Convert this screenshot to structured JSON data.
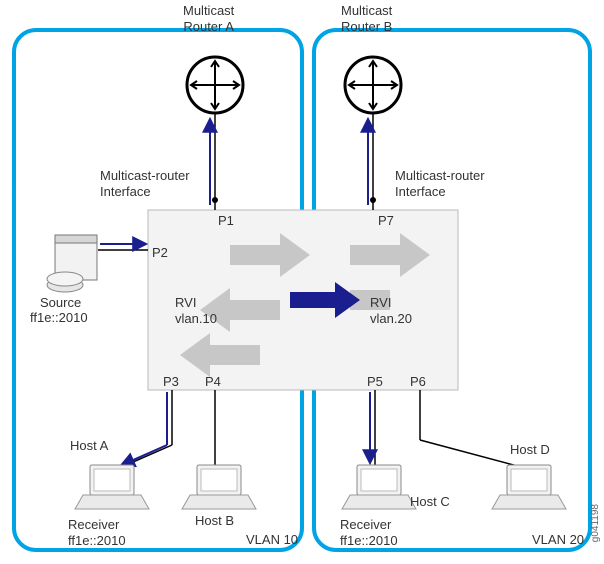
{
  "routers": {
    "a_label": "Multicast\nRouter A",
    "b_label": "Multicast\nRouter B"
  },
  "interfaces": {
    "mr_left": "Multicast-router\nInterface",
    "mr_right": "Multicast-router\nInterface"
  },
  "ports": {
    "p1": "P1",
    "p2": "P2",
    "p3": "P3",
    "p4": "P4",
    "p5": "P5",
    "p6": "P6",
    "p7": "P7"
  },
  "rvi": {
    "left": "RVI\nvlan.10",
    "right": "RVI\nvlan.20"
  },
  "source": {
    "name": "Source",
    "addr": "ff1e::2010"
  },
  "hosts": {
    "a": "Host A",
    "b": "Host B",
    "c": "Host C",
    "d": "Host D"
  },
  "receivers": {
    "left": "Receiver\nff1e::2010",
    "right": "Receiver\nff1e::2010"
  },
  "vlans": {
    "left": "VLAN 10",
    "right": "VLAN 20"
  },
  "image_id": "g041198",
  "chart_data": {
    "type": "network-diagram",
    "vlans": [
      {
        "name": "VLAN 10",
        "rvi": "vlan.10",
        "multicast_router": "Multicast Router A",
        "multicast_router_interface_port": "P1",
        "ports": [
          "P1",
          "P2",
          "P3",
          "P4"
        ],
        "source": {
          "connected_port": "P2",
          "group_address": "ff1e::2010"
        },
        "hosts": [
          {
            "name": "Host A",
            "connected_port": "P3",
            "role": "Receiver",
            "group_address": "ff1e::2010"
          },
          {
            "name": "Host B",
            "connected_port": "P4"
          }
        ]
      },
      {
        "name": "VLAN 20",
        "rvi": "vlan.20",
        "multicast_router": "Multicast Router B",
        "multicast_router_interface_port": "P7",
        "ports": [
          "P5",
          "P6",
          "P7"
        ],
        "hosts": [
          {
            "name": "Host C",
            "connected_port": "P5",
            "role": "Receiver",
            "group_address": "ff1e::2010"
          },
          {
            "name": "Host D",
            "connected_port": "P6"
          }
        ]
      }
    ],
    "inter_vlan_flow": {
      "from": "vlan.10",
      "to": "vlan.20",
      "highlighted": true
    }
  }
}
